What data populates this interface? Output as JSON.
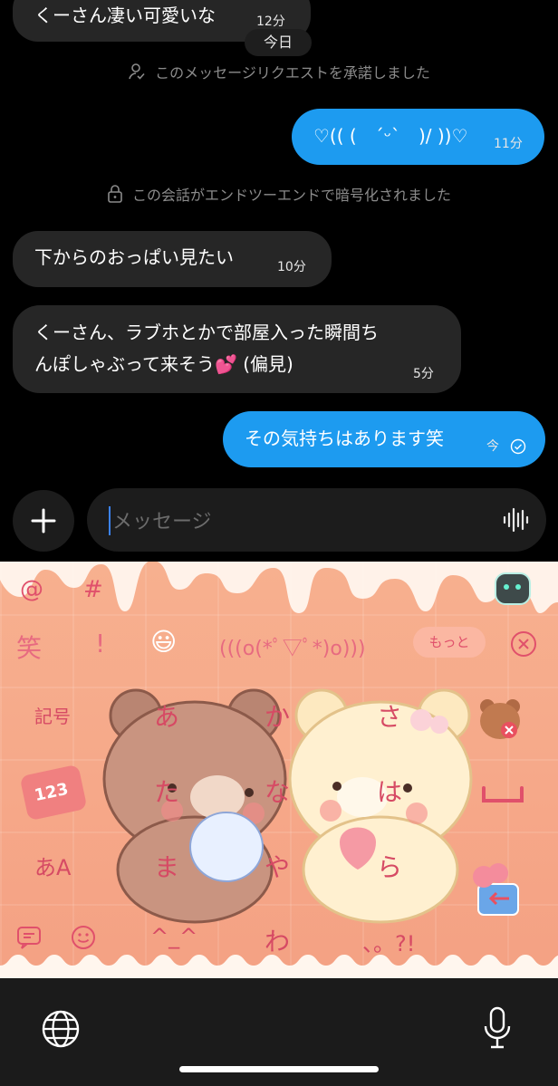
{
  "chat": {
    "top_partial": {
      "text": "くーさん凄い可愛いな",
      "time": "12分"
    },
    "date_chip": "今日",
    "request_accepted": "このメッセージリクエストを承諾しました",
    "out_1": {
      "text": "♡(( (　ˊᵕˋ　)/ ))♡",
      "time": "11分"
    },
    "e2e_notice": "この会話がエンドツーエンドで暗号化されました",
    "in_1": {
      "text": "下からのおっぱい見たい",
      "time": "10分"
    },
    "in_2": {
      "line1": "くーさん、ラブホとかで部屋入った瞬間ち",
      "line2": "んぽしゃぶって来そう💕 (偏見)",
      "time": "5分"
    },
    "out_2": {
      "text": "その気持ちはあります笑",
      "time": "今"
    }
  },
  "composer": {
    "placeholder": "メッセージ"
  },
  "keyboard": {
    "top_left_1": "@",
    "top_left_2": "#",
    "suggestions": [
      "笑",
      "!",
      "😃",
      "(((o(*ﾟ▽ﾟ*)o)))"
    ],
    "more_label": "もっと",
    "left_keys": [
      "記号",
      "123",
      "あA"
    ],
    "grid_keys": [
      "あ",
      "か",
      "さ",
      "た",
      "な",
      "は",
      "ま",
      "や",
      "ら"
    ],
    "bottom_keys": [
      "^_^",
      "わ",
      "、。?!"
    ]
  },
  "colors": {
    "accent": "#1d9bf0",
    "incoming": "#262626",
    "keyboard_bg": "#f6a889",
    "keyboard_text": "#e0506b"
  }
}
